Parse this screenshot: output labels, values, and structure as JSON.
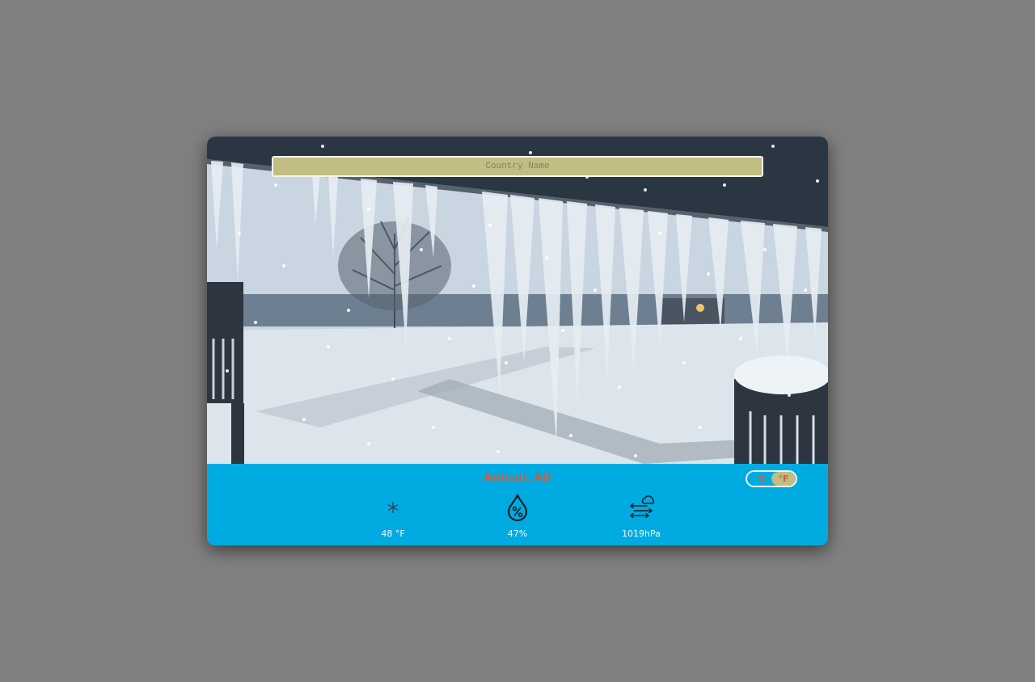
{
  "search": {
    "placeholder": "Country Name"
  },
  "weather": {
    "location": "Arinsal, AD",
    "units": {
      "celsius": "°C",
      "fahrenheit": "°F",
      "selected": "°F"
    },
    "metrics": [
      {
        "icon": "snowflake-icon",
        "value": "48 °F"
      },
      {
        "icon": "humidity-drop-icon",
        "value": "47%"
      },
      {
        "icon": "wind-cloud-icon",
        "value": "1019hPa"
      }
    ]
  },
  "colors": {
    "panel": "#00abe1",
    "search_bg": "#c2bd83",
    "accent_text": "#cc5e3e",
    "page_bg": "#808080"
  }
}
